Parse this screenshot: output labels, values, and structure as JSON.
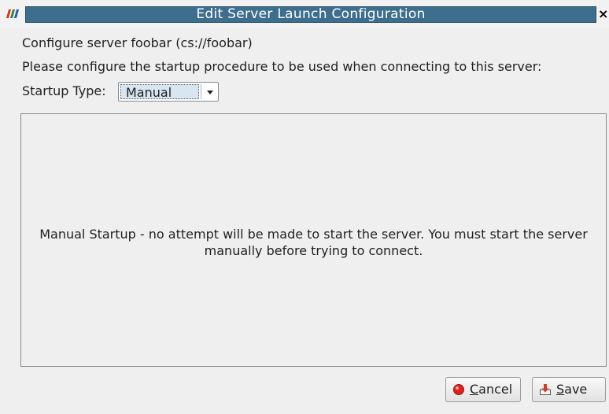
{
  "window": {
    "title": "Edit Server Launch Configuration",
    "close_glyph": "×",
    "app_icon": "paraview-logo-icon",
    "title_bar_color": "#3e6e8e"
  },
  "dialog": {
    "configure_line": "Configure server foobar (cs://foobar)",
    "instruction_line": "Please configure the startup procedure to be used when connecting to this server:",
    "startup_type_label": "Startup Type:",
    "startup_type_value": "Manual",
    "description": "Manual Startup - no attempt will be made to start the server.  You must start the server manually before trying to connect."
  },
  "buttons": {
    "cancel": {
      "mnemonic": "C",
      "rest": "ancel",
      "icon": "record-icon",
      "icon_color": "#e0201a"
    },
    "save": {
      "mnemonic": "S",
      "rest": "ave",
      "icon": "save-download-icon",
      "icon_color": "#d23a2a"
    }
  }
}
